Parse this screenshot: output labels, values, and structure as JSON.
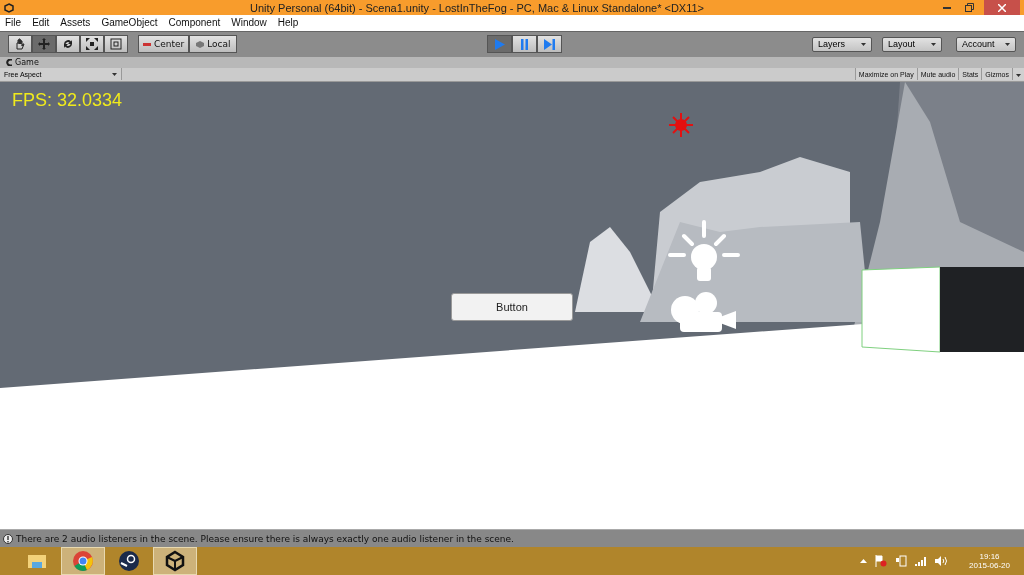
{
  "window": {
    "title": "Unity Personal (64bit) - Scena1.unity - LostInTheFog - PC, Mac & Linux Standalone* <DX11>"
  },
  "menu": [
    "File",
    "Edit",
    "Assets",
    "GameObject",
    "Component",
    "Window",
    "Help"
  ],
  "tools": [
    {
      "kind": "hand",
      "selected": false
    },
    {
      "kind": "move",
      "selected": true
    },
    {
      "kind": "rotate",
      "selected": false
    },
    {
      "kind": "scale",
      "selected": false
    },
    {
      "kind": "rect",
      "selected": false
    }
  ],
  "pivot": [
    {
      "kind": "center",
      "label": "Center"
    },
    {
      "kind": "local",
      "label": "Local"
    }
  ],
  "playback": [
    {
      "kind": "play",
      "selected": true
    },
    {
      "kind": "pause",
      "selected": false
    },
    {
      "kind": "step",
      "selected": false
    }
  ],
  "dropdowns": [
    "Layers",
    "Layout",
    "Account"
  ],
  "game_tab": {
    "title": "Game",
    "aspect": "Free Aspect",
    "toggles": [
      "Maximize on Play",
      "Mute audio",
      "Stats",
      "Gizmos"
    ]
  },
  "game_view": {
    "kind": "picture",
    "fps": "FPS: 32.0334",
    "button": "Button"
  },
  "status_bar": {
    "message": "There are 2 audio listeners in the scene. Please ensure there is always exactly one audio listener in the scene."
  },
  "taskbar": {
    "apps": [
      {
        "kind": "folder",
        "selected": false
      },
      {
        "kind": "chrome",
        "selected": true
      },
      {
        "kind": "steam",
        "selected": false
      },
      {
        "kind": "unity",
        "selected": true
      }
    ],
    "time": "19:16",
    "date": "2015-06-20"
  }
}
